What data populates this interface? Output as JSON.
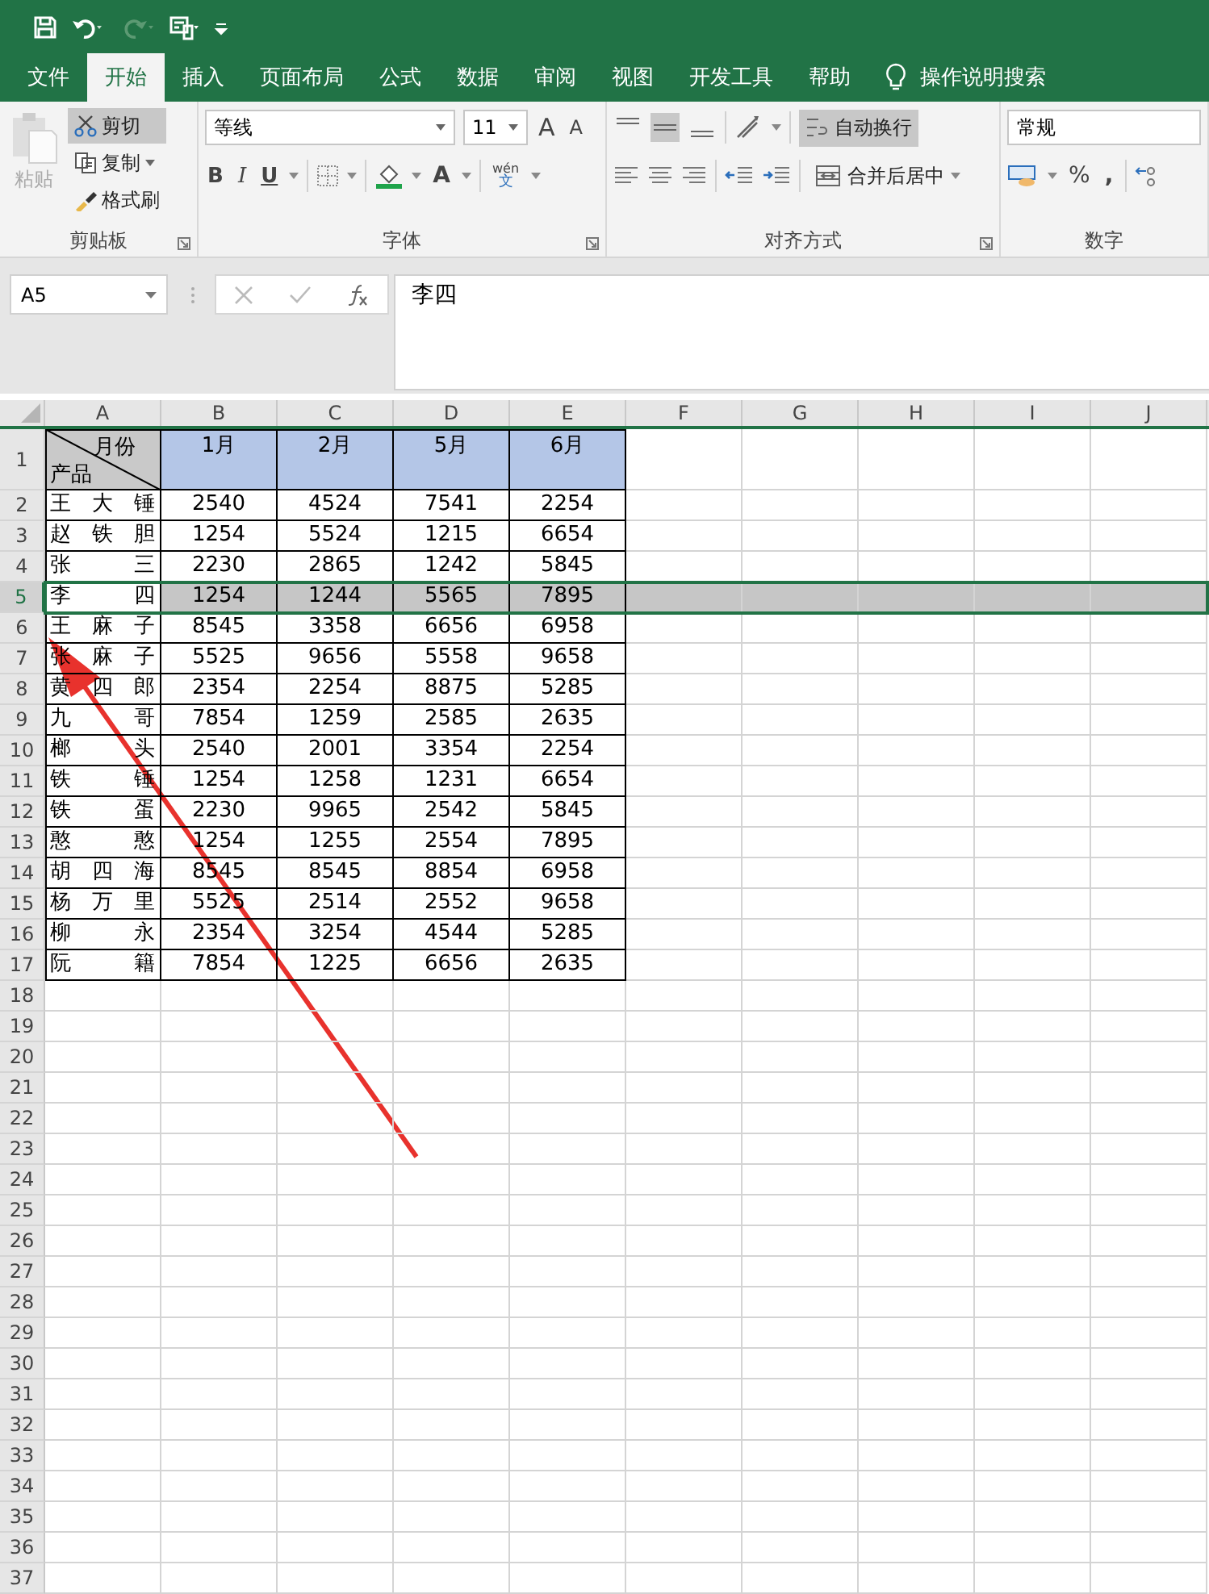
{
  "menu_tabs": [
    {
      "label": "文件",
      "selected": false
    },
    {
      "label": "开始",
      "selected": true
    },
    {
      "label": "插入",
      "selected": false
    },
    {
      "label": "页面布局",
      "selected": false
    },
    {
      "label": "公式",
      "selected": false
    },
    {
      "label": "数据",
      "selected": false
    },
    {
      "label": "审阅",
      "selected": false
    },
    {
      "label": "视图",
      "selected": false
    },
    {
      "label": "开发工具",
      "selected": false
    },
    {
      "label": "帮助",
      "selected": false
    }
  ],
  "search": {
    "placeholder": "操作说明搜索"
  },
  "clipboard": {
    "paste": {
      "label": "粘贴",
      "disabled": true
    },
    "tools": [
      {
        "label": "剪切",
        "selected": true
      },
      {
        "label": "复制",
        "selected": false
      },
      {
        "label": "格式刷",
        "selected": false
      }
    ],
    "group": "剪贴板"
  },
  "font": {
    "name": "等线",
    "size": "11",
    "grow": "A",
    "shrink": "A",
    "bold": "B",
    "italic": "I",
    "underline": "U",
    "font_color_glyph": "A",
    "phonetic_top": "wén",
    "phonetic_bottom": "文",
    "group": "字体"
  },
  "alignment": {
    "vertical": [
      {
        "selected": false
      },
      {
        "selected": true
      },
      {
        "selected": false
      }
    ],
    "wrap": {
      "label": "自动换行",
      "selected": true
    },
    "merge": "合并后居中",
    "group": "对齐方式"
  },
  "number": {
    "format": "常规",
    "percent": "%",
    "comma": ",",
    "group": "数字"
  },
  "name_box": "A5",
  "formula": "李四",
  "sheet": {
    "columns": [
      "A",
      "B",
      "C",
      "D",
      "E",
      "F",
      "G",
      "H",
      "I",
      "J"
    ],
    "header": {
      "row": "1",
      "top": "月份",
      "bottom": "产品",
      "months": [
        "1月",
        "2月",
        "5月",
        "6月"
      ]
    },
    "rows": [
      {
        "num": "2",
        "name": "王大锤",
        "values": [
          "2540",
          "4524",
          "7541",
          "2254"
        ],
        "selected": false
      },
      {
        "num": "3",
        "name": "赵铁胆",
        "values": [
          "1254",
          "5524",
          "1215",
          "6654"
        ],
        "selected": false
      },
      {
        "num": "4",
        "name": "张三",
        "values": [
          "2230",
          "2865",
          "1242",
          "5845"
        ],
        "selected": false
      },
      {
        "num": "5",
        "name": "李四",
        "values": [
          "1254",
          "1244",
          "5565",
          "7895"
        ],
        "selected": true
      },
      {
        "num": "6",
        "name": "王麻子",
        "values": [
          "8545",
          "3358",
          "6656",
          "6958"
        ],
        "selected": false
      },
      {
        "num": "7",
        "name": "张麻子",
        "values": [
          "5525",
          "9656",
          "5558",
          "9658"
        ],
        "selected": false
      },
      {
        "num": "8",
        "name": "黄四郎",
        "values": [
          "2354",
          "2254",
          "8875",
          "5285"
        ],
        "selected": false
      },
      {
        "num": "9",
        "name": "九哥",
        "values": [
          "7854",
          "1259",
          "2585",
          "2635"
        ],
        "selected": false
      },
      {
        "num": "10",
        "name": "榔头",
        "values": [
          "2540",
          "2001",
          "3354",
          "2254"
        ],
        "selected": false
      },
      {
        "num": "11",
        "name": "铁锤",
        "values": [
          "1254",
          "1258",
          "1231",
          "6654"
        ],
        "selected": false
      },
      {
        "num": "12",
        "name": "铁蛋",
        "values": [
          "2230",
          "9965",
          "2542",
          "5845"
        ],
        "selected": false
      },
      {
        "num": "13",
        "name": "憨憨",
        "values": [
          "1254",
          "1255",
          "2554",
          "7895"
        ],
        "selected": false
      },
      {
        "num": "14",
        "name": "胡四海",
        "values": [
          "8545",
          "8545",
          "8854",
          "6958"
        ],
        "selected": false
      },
      {
        "num": "15",
        "name": "杨万里",
        "values": [
          "5525",
          "2514",
          "2552",
          "9658"
        ],
        "selected": false
      },
      {
        "num": "16",
        "name": "柳永",
        "values": [
          "2354",
          "3254",
          "4544",
          "5285"
        ],
        "selected": false
      },
      {
        "num": "17",
        "name": "阮籍",
        "values": [
          "7854",
          "1225",
          "6656",
          "2635"
        ],
        "selected": false
      }
    ],
    "empty_rows": [
      "18",
      "19",
      "20",
      "21",
      "22",
      "23",
      "24",
      "25",
      "26",
      "27",
      "28",
      "29",
      "30",
      "31",
      "32",
      "33",
      "34",
      "35",
      "36",
      "37"
    ]
  }
}
